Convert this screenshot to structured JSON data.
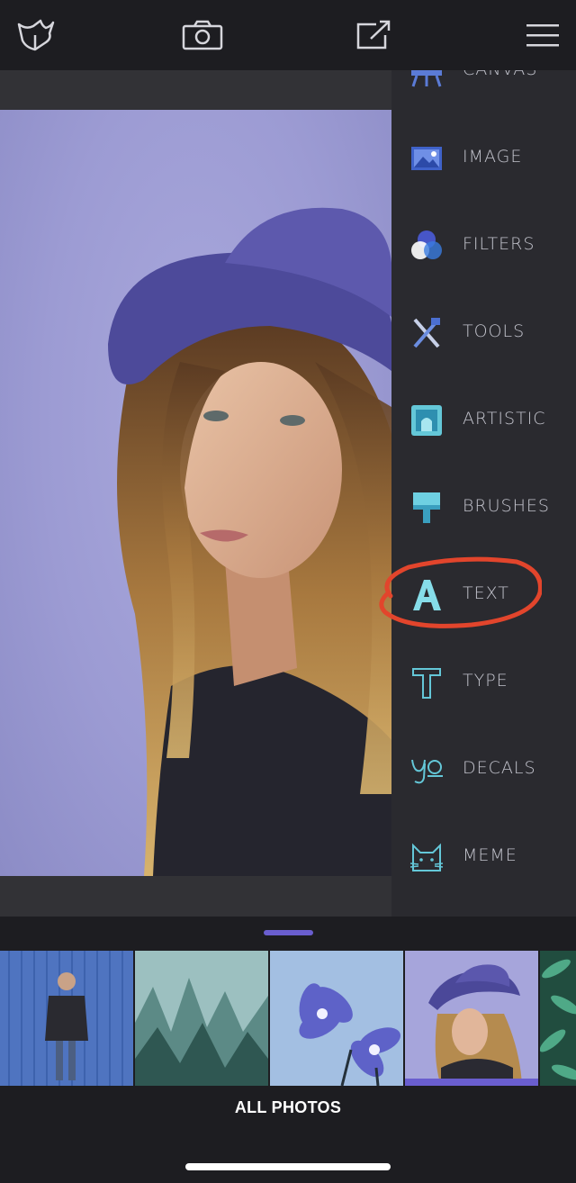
{
  "topbar": {
    "icons": [
      "logo-icon",
      "camera-icon",
      "share-icon",
      "hamburger-menu-icon"
    ]
  },
  "menu": {
    "items": [
      {
        "label": "CANVAS",
        "icon": "canvas-icon"
      },
      {
        "label": "IMAGE",
        "icon": "image-icon"
      },
      {
        "label": "FILTERS",
        "icon": "filters-icon"
      },
      {
        "label": "TOOLS",
        "icon": "tools-icon"
      },
      {
        "label": "ARTISTIC",
        "icon": "artistic-icon"
      },
      {
        "label": "BRUSHES",
        "icon": "brush-icon"
      },
      {
        "label": "TEXT",
        "icon": "text-icon"
      },
      {
        "label": "TYPE",
        "icon": "type-icon"
      },
      {
        "label": "DECALS",
        "icon": "decals-icon"
      },
      {
        "label": "MEME",
        "icon": "meme-cat-icon"
      }
    ],
    "highlighted": "TEXT"
  },
  "photo_strip": {
    "thumbnails": [
      {
        "subject": "man against blue wall"
      },
      {
        "subject": "foggy forest"
      },
      {
        "subject": "purple flowers"
      },
      {
        "subject": "woman in purple hat",
        "selected": true
      },
      {
        "subject": "green leaves"
      }
    ],
    "footer_label": "ALL PHOTOS"
  },
  "colors": {
    "accent": "#6a5ecf",
    "menu_icon_teal": "#64c7d8",
    "highlight_ring": "#e2452c"
  }
}
